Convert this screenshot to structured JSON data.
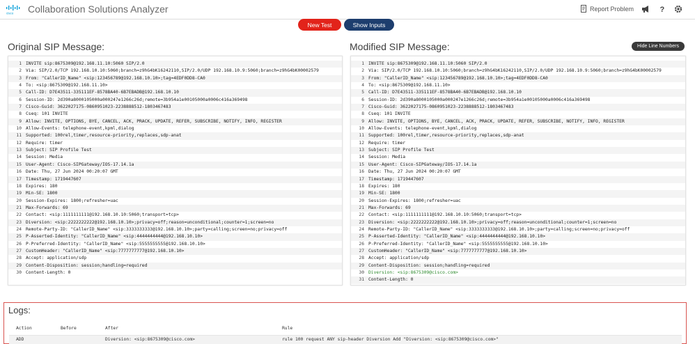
{
  "app": {
    "title": "Collaboration Solutions Analyzer"
  },
  "header": {
    "report_label": "Report Problem"
  },
  "toolbar": {
    "new_test_label": "New Test",
    "show_inputs_label": "Show Inputs",
    "hide_line_numbers_label": "Hide Line Numbers"
  },
  "original": {
    "title": "Original SIP Message:",
    "lines": [
      "INVITE sip:8675309@192.168.11.10:5060 SIP/2.0",
      "Via: SIP/2.0/TCP 192.168.10.10:5060;branch=z9hG4bK16242110,SIP/2.0/UDP 192.168.10.9:5060;branch=z9hG4bK00002579",
      "From: \"CallerID_Name\" <sip:123456789@192.168.10.10>;tag=4EDF0DD8-CA0",
      "To: <sip:8675309@192.168.11.10>",
      "Call-ID: D7E43511-335111EF-8578BA40-6B7EBADB@192.168.10.10",
      "Session-ID: 2d390a8000105000a000247e1266c26d;remote=3b954a1e00105000a0006c416a369498",
      "Cisco-Guid: 3622027175-0860951023-2238888512-1803467483",
      "Cseq: 101 INVITE",
      "Allow: INVITE, OPTIONS, BYE, CANCEL, ACK, PRACK, UPDATE, REFER, SUBSCRIBE, NOTIFY, INFO, REGISTER",
      "Allow-Events: telephone-event,kpml,dialog",
      "Supported: 100rel,timer,resource-priority,replaces,sdp-anat",
      "Require: timer",
      "Subject: SIP Profile Test",
      "Session: Media",
      "User-Agent: Cisco-SIPGateway/IOS-17.14.1a",
      "Date: Thu, 27 Jun 2024 00:20:07 GMT",
      "Timestamp: 1719447607",
      "Expires: 180",
      "Min-SE: 1800",
      "Session-Expires: 1800;refresher=uac",
      "Max-Forwards: 69",
      "Contact: <sip:1111111111@192.168.10.10:5060;transport=tcp>",
      "Diversion: <sip:2222222222@192.168.10.10>;privacy=off;reason=unconditional;counter=1;screen=no",
      "Remote-Party-ID: \"CallerID_Name\" <sip:3333333333@192.168.10.10>;party=calling;screen=no;privacy=off",
      "P-Asserted-Identity: \"CallerID_Name\" <sip:4444444444@192.168.10.10>",
      "P-Preferred-Identity: \"CallerID_Name\" <sip:5555555555@192.168.10.10>",
      "CustomHeader: \"CallerID_Name\" <sip:7777777777@192.168.10.10>",
      "Accept: application/sdp",
      "Content-Disposition: session;handling=required",
      "Content-Length: 0"
    ]
  },
  "modified": {
    "title": "Modified SIP Message:",
    "lines": [
      "INVITE sip:8675309@192.168.11.10:5060 SIP/2.0",
      "Via: SIP/2.0/TCP 192.168.10.10:5060;branch=z9hG4bK16242110,SIP/2.0/UDP 192.168.10.9:5060;branch=z9hG4bK00002579",
      "From: \"CallerID_Name\" <sip:123456789@192.168.10.10>;tag=4EDF0DD8-CA0",
      "To: <sip:8675309@192.168.11.10>",
      "Call-ID: D7E43511-335111EF-8578BA40-6B7EBADB@192.168.10.10",
      "Session-ID: 2d390a8000105000a000247e1266c26d;remote=3b954a1e00105000a0006c416a369498",
      "Cisco-Guid: 3622027175-0860951023-2238888512-1803467483",
      "Cseq: 101 INVITE",
      "Allow: INVITE, OPTIONS, BYE, CANCEL, ACK, PRACK, UPDATE, REFER, SUBSCRIBE, NOTIFY, INFO, REGISTER",
      "Allow-Events: telephone-event,kpml,dialog",
      "Supported: 100rel,timer,resource-priority,replaces,sdp-anat",
      "Require: timer",
      "Subject: SIP Profile Test",
      "Session: Media",
      "User-Agent: Cisco-SIPGateway/IOS-17.14.1a",
      "Date: Thu, 27 Jun 2024 00:20:07 GMT",
      "Timestamp: 1719447607",
      "Expires: 180",
      "Min-SE: 1800",
      "Session-Expires: 1800;refresher=uac",
      "Max-Forwards: 69",
      "Contact: <sip:1111111111@192.168.10.10:5060;transport=tcp>",
      "Diversion: <sip:2222222222@192.168.10.10>;privacy=off;reason=unconditional;counter=1;screen=no",
      "Remote-Party-ID: \"CallerID_Name\" <sip:3333333333@192.168.10.10>;party=calling;screen=no;privacy=off",
      "P-Asserted-Identity: \"CallerID_Name\" <sip:4444444444@192.168.10.10>",
      "P-Preferred-Identity: \"CallerID_Name\" <sip:5555555555@192.168.10.10>",
      "CustomHeader: \"CallerID_Name\" <sip:7777777777@192.168.10.10>",
      "Accept: application/sdp",
      "Content-Disposition: session;handling=required",
      "Diversion: <sip:8675309@cisco.com>",
      "Content-Length: 0"
    ],
    "added_line": 30
  },
  "logs": {
    "title": "Logs:",
    "columns": [
      "Action",
      "Before",
      "After",
      "Rule"
    ],
    "rows": [
      {
        "action": "ADD",
        "before": "",
        "after": "Diversion: <sip:8675309@cisco.com>",
        "rule": "rule 100 request ANY sip-header Diversion Add \"Diversion: <sip:8675309@cisco.com>\""
      }
    ]
  },
  "colors": {
    "brand": "#049fd9",
    "danger": "#e2231a",
    "navy": "#1d3e6e",
    "added_text": "#2e8b2e"
  }
}
